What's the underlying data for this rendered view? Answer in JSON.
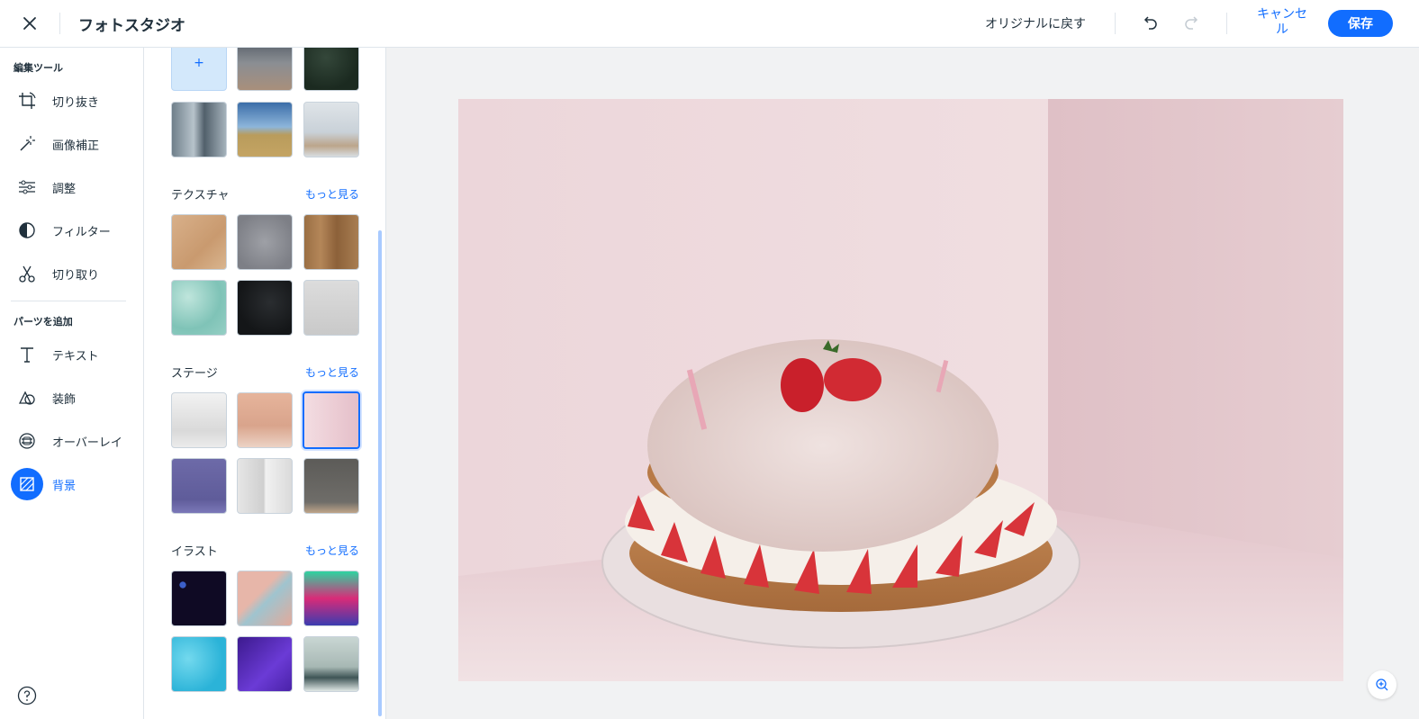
{
  "header": {
    "title": "フォトスタジオ",
    "revert_label": "オリジナルに戻す",
    "cancel_label": "キャンセル",
    "save_label": "保存"
  },
  "sidebar": {
    "edit_tools_title": "編集ツール",
    "edit_tools": [
      {
        "label": "切り抜き",
        "icon": "crop-rotate-icon"
      },
      {
        "label": "画像補正",
        "icon": "magic-wand-icon"
      },
      {
        "label": "調整",
        "icon": "sliders-icon"
      },
      {
        "label": "フィルター",
        "icon": "filter-icon"
      },
      {
        "label": "切り取り",
        "icon": "scissors-icon"
      }
    ],
    "add_parts_title": "パーツを追加",
    "add_parts": [
      {
        "label": "テキスト",
        "icon": "text-icon"
      },
      {
        "label": "装飾",
        "icon": "shapes-icon"
      },
      {
        "label": "オーバーレイ",
        "icon": "overlay-icon"
      },
      {
        "label": "背景",
        "icon": "background-icon",
        "active": true
      }
    ],
    "help_icon": "help-icon"
  },
  "panel": {
    "upload_label": "+",
    "groups": [
      {
        "title": "テクスチャ",
        "more": "もっと見る"
      },
      {
        "title": "ステージ",
        "more": "もっと見る"
      },
      {
        "title": "イラスト",
        "more": "もっと見る"
      }
    ]
  },
  "canvas": {
    "zoom_icon": "zoom-in-icon"
  },
  "colors": {
    "accent": "#116dff",
    "canvas_bg": "#f1f2f3"
  }
}
